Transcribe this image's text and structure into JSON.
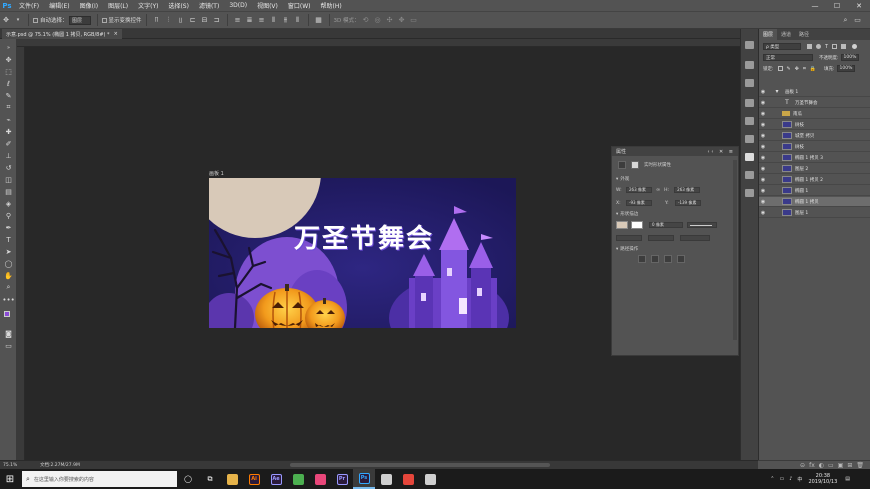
{
  "menubar": {
    "logo": "Ps",
    "items": [
      "文件(F)",
      "编辑(E)",
      "图像(I)",
      "图层(L)",
      "文字(Y)",
      "选择(S)",
      "滤镜(T)",
      "3D(D)",
      "视图(V)",
      "窗口(W)",
      "帮助(H)"
    ],
    "window_controls": [
      "—",
      "☐",
      "✕"
    ]
  },
  "optbar": {
    "auto_select_label": "自动选择：",
    "auto_select_value": "图层",
    "show_transform_label": "显示变换控件",
    "mode_3d_label": "3D 模式："
  },
  "document": {
    "tab_title": "示意.psd @ 75.1% (椭圆 1 拷贝, RGB/8#) *",
    "tab_close": "×",
    "artboard_label": "画板 1",
    "banner_title": "万圣节舞会"
  },
  "properties": {
    "header": "属性",
    "header_controls": "‹‹ ✕ ≡",
    "shape_type": "实时形状属性",
    "w_label": "W:",
    "w_value": "263 像素",
    "h_label": "H:",
    "h_value": "263 像素",
    "x_label": "X:",
    "x_value": "-93 像素",
    "y_label": "Y:",
    "y_value": "-139 像素",
    "link_icon": "∞",
    "appearance_title": "外观",
    "fill_stroke_title": "形状描边",
    "stroke_width": "0 像素",
    "path_ops_title": "路径操作",
    "section_arrow": "▾"
  },
  "layers": {
    "tabs": [
      "图层",
      "通道",
      "路径"
    ],
    "filter_label": "ρ 类型",
    "blend_mode": "正常",
    "opacity_label": "不透明度:",
    "opacity_value": "100%",
    "lock_label": "锁定:",
    "fill_label": "填充:",
    "fill_value": "100%",
    "items": [
      {
        "name": "画板 1",
        "kind": "artboard",
        "selected": false
      },
      {
        "name": "万圣节舞会",
        "kind": "text",
        "selected": false
      },
      {
        "name": "南瓜",
        "kind": "folder",
        "selected": false
      },
      {
        "name": "树枝",
        "kind": "layer",
        "selected": false
      },
      {
        "name": "城堡 拷贝",
        "kind": "layer",
        "selected": false
      },
      {
        "name": "树枝",
        "kind": "layer",
        "selected": false
      },
      {
        "name": "椭圆 1 拷贝 3",
        "kind": "layer",
        "selected": false
      },
      {
        "name": "图层 2",
        "kind": "layer",
        "selected": false
      },
      {
        "name": "椭圆 1 拷贝 2",
        "kind": "layer",
        "selected": false
      },
      {
        "name": "椭圆 1",
        "kind": "layer",
        "selected": false
      },
      {
        "name": "椭圆 1 拷贝",
        "kind": "layer",
        "selected": true
      },
      {
        "name": "图层 1",
        "kind": "layer",
        "selected": false
      }
    ],
    "bottom_icons": [
      "⊝",
      "fx",
      "◐",
      "▭",
      "▣",
      "⊞",
      "🗑"
    ]
  },
  "status": {
    "zoom": "75.1%",
    "doc_info": "文档:2.27M/27.9M"
  },
  "taskbar": {
    "search_placeholder": "在这里输入你要搜索的内容",
    "time": "20:38",
    "date": "2019/10/13",
    "apps": [
      {
        "name": "folder",
        "label": "",
        "color": "#e6b34a"
      },
      {
        "name": "ai",
        "label": "Ai",
        "color": "#ff7c00"
      },
      {
        "name": "ae",
        "label": "Ae",
        "color": "#9999ff"
      },
      {
        "name": "chrome",
        "label": "",
        "color": "#4caf50"
      },
      {
        "name": "app-pink",
        "label": "",
        "color": "#e9477a"
      },
      {
        "name": "pr",
        "label": "Pr",
        "color": "#9999ff"
      },
      {
        "name": "ps",
        "label": "Ps",
        "color": "#31a8ff"
      },
      {
        "name": "app-circle",
        "label": "",
        "color": "#cfcfcf"
      },
      {
        "name": "chrome2",
        "label": "",
        "color": "#e5463b"
      },
      {
        "name": "app-last",
        "label": "",
        "color": "#cfcfcf"
      }
    ]
  },
  "colors": {
    "foreground": "#8a4bd6",
    "background": "#1a1a1a",
    "banner_bg": "#231d63",
    "accent_blue": "#31a8ff"
  }
}
